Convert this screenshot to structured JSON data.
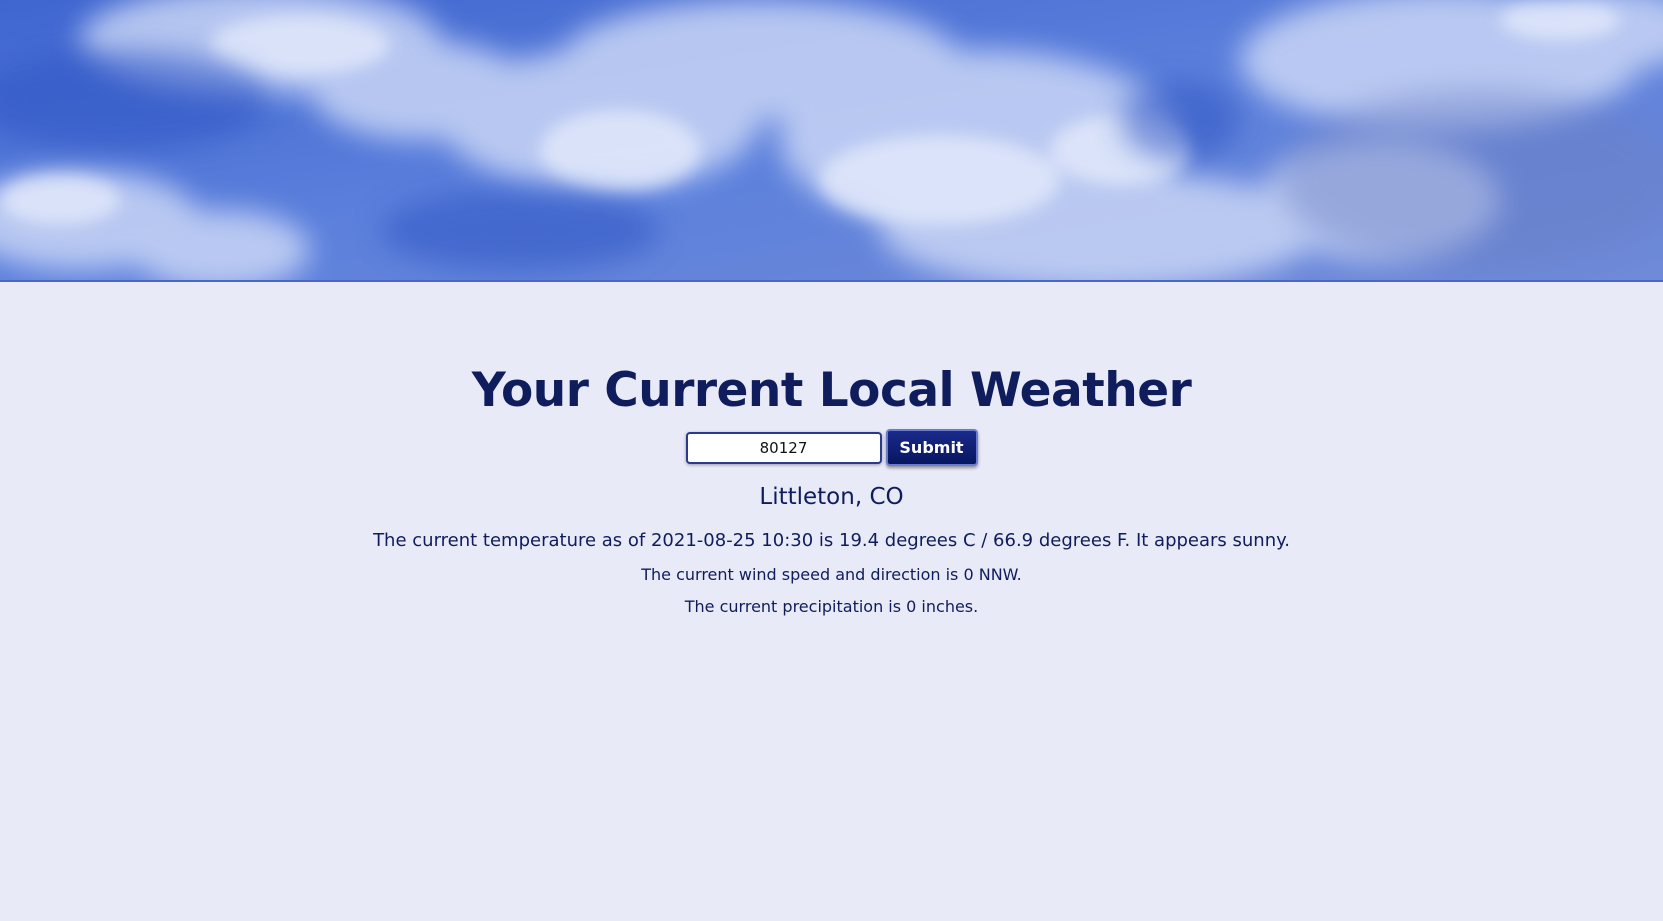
{
  "header": {
    "banner": "sky-clouds-image"
  },
  "main": {
    "title": "Your Current Local Weather",
    "search": {
      "value": "80127",
      "submit_label": "Submit"
    },
    "location": "Littleton, CO",
    "temperature_text": "The current temperature as of 2021-08-25 10:30 is 19.4 degrees C / 66.9 degrees F. It appears sunny.",
    "wind_text": "The current wind speed and direction is 0 NNW.",
    "precipitation_text": "The current precipitation is 0 inches."
  },
  "colors": {
    "background": "#e8eaf8",
    "text": "#0f1d5c",
    "button": "#0b1a6e",
    "sky": "#4e76d6"
  }
}
